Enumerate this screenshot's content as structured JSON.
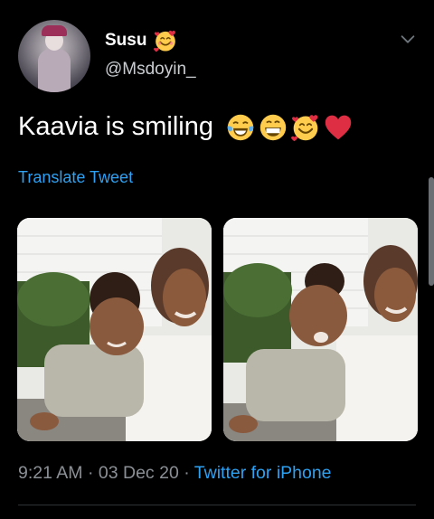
{
  "author": {
    "display_name": "Susu",
    "username": "@Msdoyin_",
    "name_emoji": "smiling-face-with-hearts"
  },
  "tweet": {
    "text": "Kaavia is smiling",
    "emojis": [
      "face-with-tears-of-joy",
      "grinning-face-with-smiling-eyes",
      "smiling-face-with-hearts",
      "red-heart"
    ],
    "translate_label": "Translate Tweet"
  },
  "media": [
    {
      "alt": "Photo 1",
      "description": ""
    },
    {
      "alt": "Photo 2",
      "description": ""
    }
  ],
  "meta": {
    "time": "9:21 AM",
    "separator": "·",
    "date": "03 Dec 20",
    "source": "Twitter for iPhone"
  },
  "colors": {
    "background": "#000000",
    "link": "#2ea1f2",
    "secondary_text": "#8b9096",
    "primary_text": "#ffffff"
  },
  "icons": {
    "caret": "chevron-down-icon"
  }
}
